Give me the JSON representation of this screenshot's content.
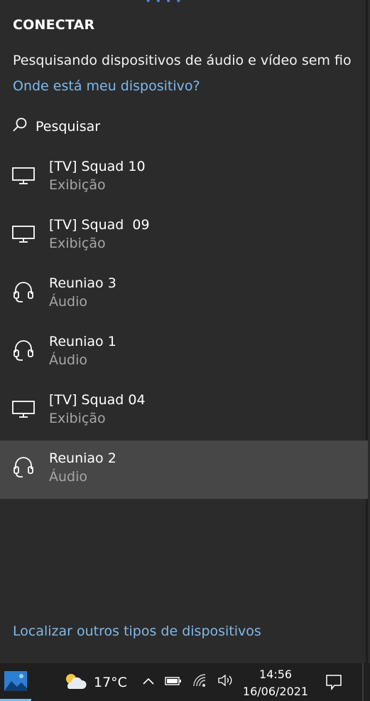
{
  "panel": {
    "title": "CONECTAR",
    "status": "Pesquisando dispositivos de áudio e vídeo sem fio",
    "help_link": "Onde está meu dispositivo?",
    "search_label": "Pesquisar",
    "find_other_link": "Localizar outros tipos de dispositivos"
  },
  "devices": [
    {
      "name": "[TV] Squad 10",
      "type": "Exibição",
      "icon": "monitor-icon",
      "selected": false
    },
    {
      "name": "[TV] Squad  09",
      "type": "Exibição",
      "icon": "monitor-icon",
      "selected": false
    },
    {
      "name": "Reuniao 3",
      "type": "Áudio",
      "icon": "headset-icon",
      "selected": false
    },
    {
      "name": "Reuniao 1",
      "type": "Áudio",
      "icon": "headset-icon",
      "selected": false
    },
    {
      "name": "[TV] Squad 04",
      "type": "Exibição",
      "icon": "monitor-icon",
      "selected": false
    },
    {
      "name": "Reuniao 2",
      "type": "Áudio",
      "icon": "headset-icon",
      "selected": true
    }
  ],
  "taskbar": {
    "temperature": "17°C",
    "time": "14:56",
    "date": "16/06/2021"
  },
  "colors": {
    "background": "#2b2b2b",
    "selected": "#474747",
    "link": "#7fb8ea",
    "secondary_text": "#a6a6a6",
    "taskbar": "#1f1f1f"
  }
}
